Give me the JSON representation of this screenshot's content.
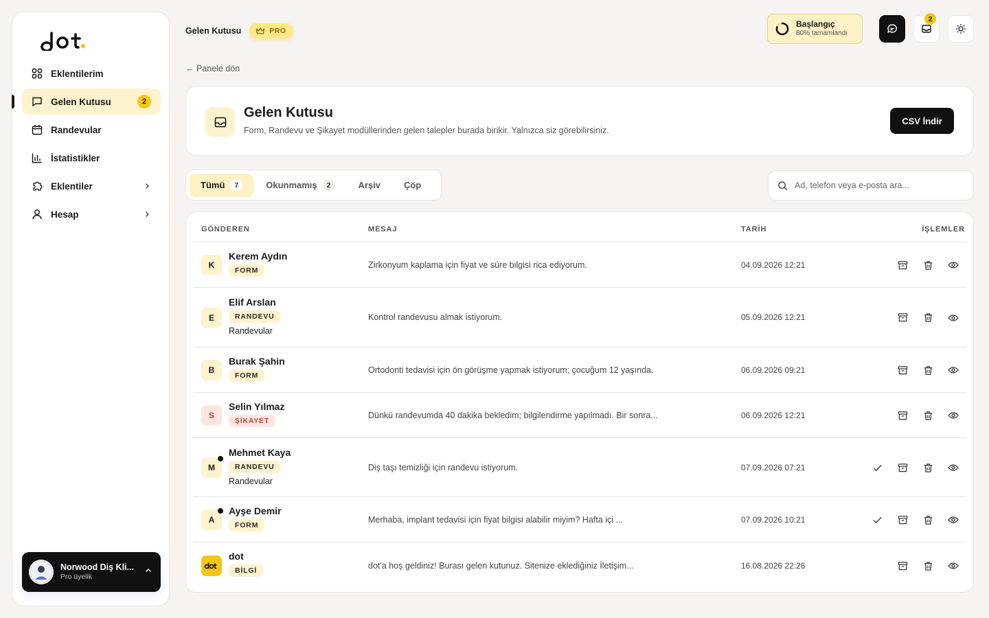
{
  "app": {
    "logo_text": "dot."
  },
  "sidebar": {
    "items": [
      {
        "label": "Eklentilerim",
        "icon": "grid-icon"
      },
      {
        "label": "Gelen Kutusu",
        "icon": "message-square-icon",
        "badge": "2",
        "active": true
      },
      {
        "label": "Randevular",
        "icon": "calendar-icon"
      },
      {
        "label": "İstatistikler",
        "icon": "bar-chart-icon"
      },
      {
        "label": "Eklentiler",
        "icon": "puzzle-icon",
        "chevron": true
      },
      {
        "label": "Hesap",
        "icon": "user-icon",
        "chevron": true
      }
    ],
    "user": {
      "name": "Norwood Diş Kli...",
      "plan": "Pro üyelik"
    }
  },
  "topbar": {
    "breadcrumb": "Gelen Kutusu",
    "pro_badge": "PRO",
    "progress": {
      "title": "Başlangıç",
      "subtitle": "80% tamamlandı",
      "value": 0.8
    },
    "notifications_count": "2"
  },
  "back_link": "← Panele dön",
  "header": {
    "title": "Gelen Kutusu",
    "description": "Form, Randevu ve Şikayet modüllerinden gelen talepler burada birikir. Yalnızca siz görebilirsiniz.",
    "csv_button": "CSV İndir"
  },
  "tabs": [
    {
      "label": "Tümü",
      "count": "7",
      "active": true
    },
    {
      "label": "Okunmamış",
      "count": "2"
    },
    {
      "label": "Arşiv"
    },
    {
      "label": "Çöp"
    }
  ],
  "search": {
    "placeholder": "Ad, telefon veya e-posta ara..."
  },
  "table": {
    "headers": {
      "sender": "GÖNDEREN",
      "message": "MESAJ",
      "date": "TARİH",
      "actions": "İŞLEMLER"
    },
    "rows": [
      {
        "initial": "K",
        "name": "Kerem Aydın",
        "tag": "FORM",
        "message": "Zirkonyum kaplama için fiyat ve süre bilgisi rica ediyorum.",
        "date": "04.09.2026 12:21"
      },
      {
        "initial": "E",
        "name": "Elif Arslan",
        "tag": "RANDEVU",
        "sub": "Randevular",
        "message": "Kontrol randevusu almak istiyorum.",
        "date": "05.09.2026 12:21"
      },
      {
        "initial": "B",
        "name": "Burak Şahin",
        "tag": "FORM",
        "message": "Ortodonti tedavisi için ön görüşme yapmak istiyorum; çocuğum 12 yaşında.",
        "date": "06.09.2026 09:21"
      },
      {
        "initial": "S",
        "name": "Selin Yılmaz",
        "tag": "ŞİKAYET",
        "tag_style": "red",
        "message": "Dünkü randevumda 40 dakika bekledim; bilgilendirme yapılmadı. Bir sonra...",
        "date": "06.09.2026 12:21"
      },
      {
        "initial": "M",
        "name": "Mehmet Kaya",
        "tag": "RANDEVU",
        "sub": "Randevular",
        "message": "Diş taşı temizliği için randevu istiyorum.",
        "date": "07.09.2026 07:21",
        "unread": true
      },
      {
        "initial": "A",
        "name": "Ayşe Demir",
        "tag": "FORM",
        "message": "Merhaba, implant tedavisi için fiyat bilgisi alabilir miyim? Hafta içi ...",
        "date": "07.09.2026 10:21",
        "unread": true
      },
      {
        "initial": "dot",
        "name": "dot",
        "tag": "BİLGİ",
        "message": "dot'a hoş geldiniz! Burası gelen kutunuz. Sitenize eklediğiniz İletişim...",
        "date": "16.08.2026 22:26",
        "logo": true
      }
    ]
  },
  "colors": {
    "accent": "#f5c518",
    "accent_soft": "#fdf3cf",
    "danger_soft": "#fde6e1",
    "danger": "#c0482e",
    "dark": "#111111"
  }
}
